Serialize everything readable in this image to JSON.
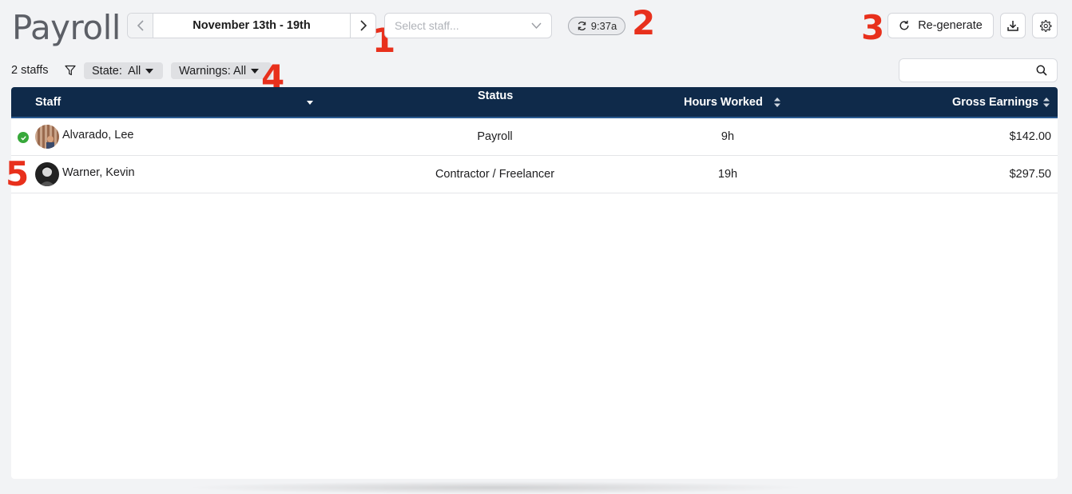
{
  "header": {
    "title": "Payroll",
    "date_range": "November 13th - 19th",
    "staff_select_placeholder": "Select staff...",
    "sync_time": "9:37a",
    "regenerate_label": "Re-generate"
  },
  "markers": [
    "1",
    "2",
    "3",
    "4",
    "5"
  ],
  "filters": {
    "staff_count": "2 staffs",
    "state_label": "State:  All",
    "warnings_label": "Warnings: All",
    "search_value": ""
  },
  "table": {
    "columns": {
      "staff": "Staff",
      "status": "Status",
      "hours": "Hours Worked",
      "gross": "Gross Earnings"
    },
    "rows": [
      {
        "name": "Alvarado, Lee",
        "status": "Payroll",
        "hours": "9h",
        "gross": "$142.00",
        "verified": true
      },
      {
        "name": "Warner, Kevin",
        "status": "Contractor / Freelancer",
        "hours": "19h",
        "gross": "$297.50",
        "verified": false
      }
    ]
  },
  "colors": {
    "header_bg": "#0f2a4a",
    "accent_red": "#e8301c",
    "success_green": "#37a83a",
    "page_bg": "#f2f3f5"
  },
  "icons": [
    "chevron-left-icon",
    "chevron-right-icon",
    "chevron-down-icon",
    "refresh-icon",
    "download-icon",
    "gear-icon",
    "filter-icon",
    "search-icon",
    "check-icon",
    "sort-icon"
  ]
}
